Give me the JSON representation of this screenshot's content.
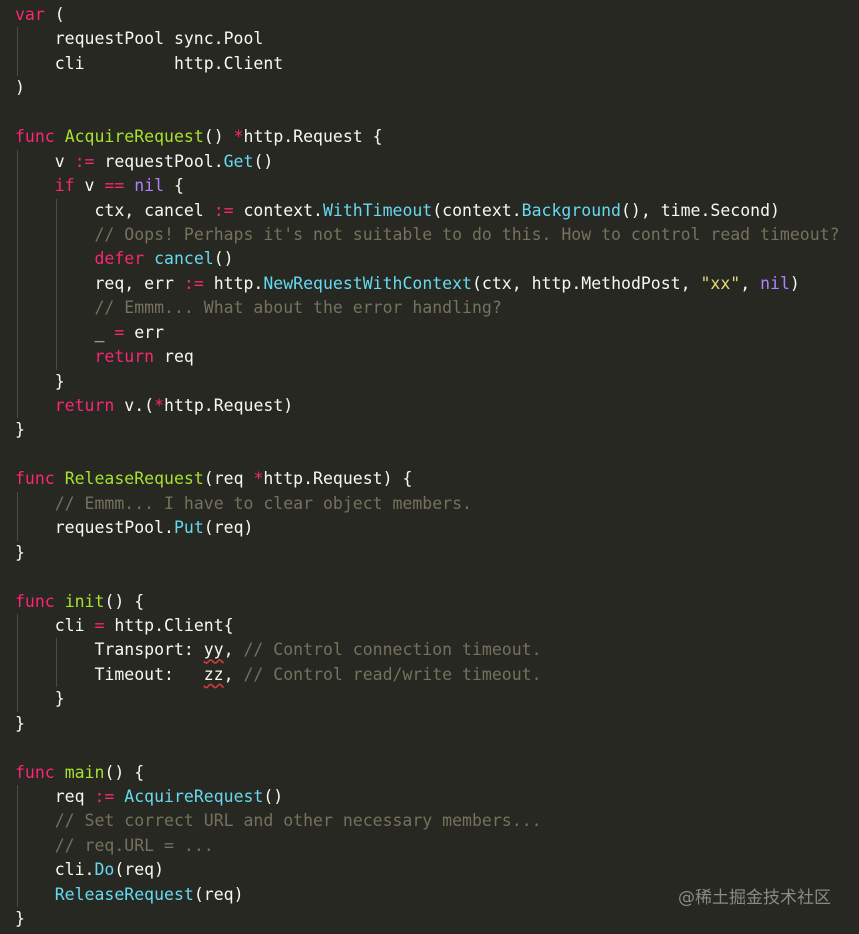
{
  "colors": {
    "background": "#272822",
    "plain": "#f8f8f2",
    "keyword": "#f92672",
    "function_name": "#a6e22e",
    "call": "#66d9ef",
    "string": "#e6db74",
    "constant": "#ae81ff",
    "comment": "#75715e",
    "squiggle": "#d23b3b"
  },
  "watermark": "@稀土掘金技术社区",
  "lines": [
    [
      [
        "kw",
        "var"
      ],
      [
        "plain",
        " ("
      ]
    ],
    [
      [
        "plain",
        "    requestPool sync.Pool"
      ]
    ],
    [
      [
        "plain",
        "    cli         http.Client"
      ]
    ],
    [
      [
        "plain",
        ")"
      ]
    ],
    [],
    [
      [
        "kw",
        "func"
      ],
      [
        "plain",
        " "
      ],
      [
        "fn",
        "AcquireRequest"
      ],
      [
        "plain",
        "() "
      ],
      [
        "kw",
        "*"
      ],
      [
        "plain",
        "http.Request {"
      ]
    ],
    [
      [
        "plain",
        "    v "
      ],
      [
        "kw",
        ":="
      ],
      [
        "plain",
        " requestPool."
      ],
      [
        "call",
        "Get"
      ],
      [
        "plain",
        "()"
      ]
    ],
    [
      [
        "plain",
        "    "
      ],
      [
        "kw",
        "if"
      ],
      [
        "plain",
        " v "
      ],
      [
        "kw",
        "=="
      ],
      [
        "plain",
        " "
      ],
      [
        "const",
        "nil"
      ],
      [
        "plain",
        " {"
      ]
    ],
    [
      [
        "plain",
        "        ctx, cancel "
      ],
      [
        "kw",
        ":="
      ],
      [
        "plain",
        " context."
      ],
      [
        "call",
        "WithTimeout"
      ],
      [
        "plain",
        "(context."
      ],
      [
        "call",
        "Background"
      ],
      [
        "plain",
        "(), time.Second)"
      ]
    ],
    [
      [
        "plain",
        "        "
      ],
      [
        "cm",
        "// Oops! Perhaps it's not suitable to do this. How to control read timeout?"
      ]
    ],
    [
      [
        "plain",
        "        "
      ],
      [
        "kw",
        "defer"
      ],
      [
        "plain",
        " "
      ],
      [
        "call",
        "cancel"
      ],
      [
        "plain",
        "()"
      ]
    ],
    [
      [
        "plain",
        "        req, err "
      ],
      [
        "kw",
        ":="
      ],
      [
        "plain",
        " http."
      ],
      [
        "call",
        "NewRequestWithContext"
      ],
      [
        "plain",
        "(ctx, http.MethodPost, "
      ],
      [
        "str",
        "\"xx\""
      ],
      [
        "plain",
        ", "
      ],
      [
        "const",
        "nil"
      ],
      [
        "plain",
        ")"
      ]
    ],
    [
      [
        "plain",
        "        "
      ],
      [
        "cm",
        "// Emmm... What about the error handling?"
      ]
    ],
    [
      [
        "plain",
        "        _ "
      ],
      [
        "kw",
        "="
      ],
      [
        "plain",
        " err"
      ]
    ],
    [
      [
        "plain",
        "        "
      ],
      [
        "kw",
        "return"
      ],
      [
        "plain",
        " req"
      ]
    ],
    [
      [
        "plain",
        "    }"
      ]
    ],
    [
      [
        "plain",
        "    "
      ],
      [
        "kw",
        "return"
      ],
      [
        "plain",
        " v.("
      ],
      [
        "kw",
        "*"
      ],
      [
        "plain",
        "http.Request)"
      ]
    ],
    [
      [
        "plain",
        "}"
      ]
    ],
    [],
    [
      [
        "kw",
        "func"
      ],
      [
        "plain",
        " "
      ],
      [
        "fn",
        "ReleaseRequest"
      ],
      [
        "plain",
        "(req "
      ],
      [
        "kw",
        "*"
      ],
      [
        "plain",
        "http.Request) {"
      ]
    ],
    [
      [
        "plain",
        "    "
      ],
      [
        "cm",
        "// Emmm... I have to clear object members."
      ]
    ],
    [
      [
        "plain",
        "    requestPool."
      ],
      [
        "call",
        "Put"
      ],
      [
        "plain",
        "(req)"
      ]
    ],
    [
      [
        "plain",
        "}"
      ]
    ],
    [],
    [
      [
        "kw",
        "func"
      ],
      [
        "plain",
        " "
      ],
      [
        "fn",
        "init"
      ],
      [
        "plain",
        "() {"
      ]
    ],
    [
      [
        "plain",
        "    cli "
      ],
      [
        "kw",
        "="
      ],
      [
        "plain",
        " http.Client{"
      ]
    ],
    [
      [
        "plain",
        "        Transport: "
      ],
      [
        "sq",
        "yy"
      ],
      [
        "plain",
        ", "
      ],
      [
        "cm",
        "// Control connection timeout."
      ]
    ],
    [
      [
        "plain",
        "        Timeout:   "
      ],
      [
        "sq",
        "zz"
      ],
      [
        "plain",
        ", "
      ],
      [
        "cm",
        "// Control read/write timeout."
      ]
    ],
    [
      [
        "plain",
        "    }"
      ]
    ],
    [
      [
        "plain",
        "}"
      ]
    ],
    [],
    [
      [
        "kw",
        "func"
      ],
      [
        "plain",
        " "
      ],
      [
        "fn",
        "main"
      ],
      [
        "plain",
        "() {"
      ]
    ],
    [
      [
        "plain",
        "    req "
      ],
      [
        "kw",
        ":="
      ],
      [
        "plain",
        " "
      ],
      [
        "call",
        "AcquireRequest"
      ],
      [
        "plain",
        "()"
      ]
    ],
    [
      [
        "plain",
        "    "
      ],
      [
        "cm",
        "// Set correct URL and other necessary members..."
      ]
    ],
    [
      [
        "plain",
        "    "
      ],
      [
        "cm",
        "// req.URL = ..."
      ]
    ],
    [
      [
        "plain",
        "    cli."
      ],
      [
        "call",
        "Do"
      ],
      [
        "plain",
        "(req)"
      ]
    ],
    [
      [
        "plain",
        "    "
      ],
      [
        "call",
        "ReleaseRequest"
      ],
      [
        "plain",
        "(req)"
      ]
    ],
    [
      [
        "plain",
        "}"
      ]
    ]
  ]
}
